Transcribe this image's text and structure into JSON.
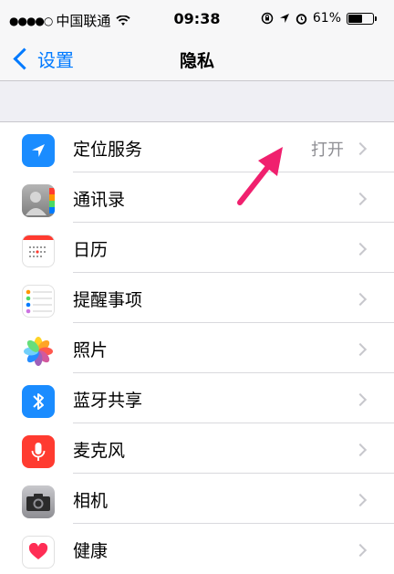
{
  "status": {
    "dots": "●●●●○",
    "carrier": "中国联通",
    "time": "09:38",
    "battery_pct": "61%",
    "battery_level": 0.61
  },
  "nav": {
    "back_label": "设置",
    "title": "隐私"
  },
  "rows": [
    {
      "label": "定位服务",
      "value": "打开",
      "icon": "location-arrow-icon",
      "color": "#1a8cff"
    },
    {
      "label": "通讯录",
      "value": "",
      "icon": "contacts-icon",
      "color": "#9a9a9a"
    },
    {
      "label": "日历",
      "value": "",
      "icon": "calendar-icon",
      "color": "#ffffff"
    },
    {
      "label": "提醒事项",
      "value": "",
      "icon": "reminders-icon",
      "color": "#ffffff"
    },
    {
      "label": "照片",
      "value": "",
      "icon": "photos-icon",
      "color": "#ffffff"
    },
    {
      "label": "蓝牙共享",
      "value": "",
      "icon": "bluetooth-icon",
      "color": "#1a8cff"
    },
    {
      "label": "麦克风",
      "value": "",
      "icon": "microphone-icon",
      "color": "#ff3b30"
    },
    {
      "label": "相机",
      "value": "",
      "icon": "camera-icon",
      "color": "#8e8e93"
    },
    {
      "label": "健康",
      "value": "",
      "icon": "heart-icon",
      "color": "#ffffff"
    }
  ],
  "colors": {
    "accent": "#007aff",
    "annotation": "#f0206e"
  }
}
